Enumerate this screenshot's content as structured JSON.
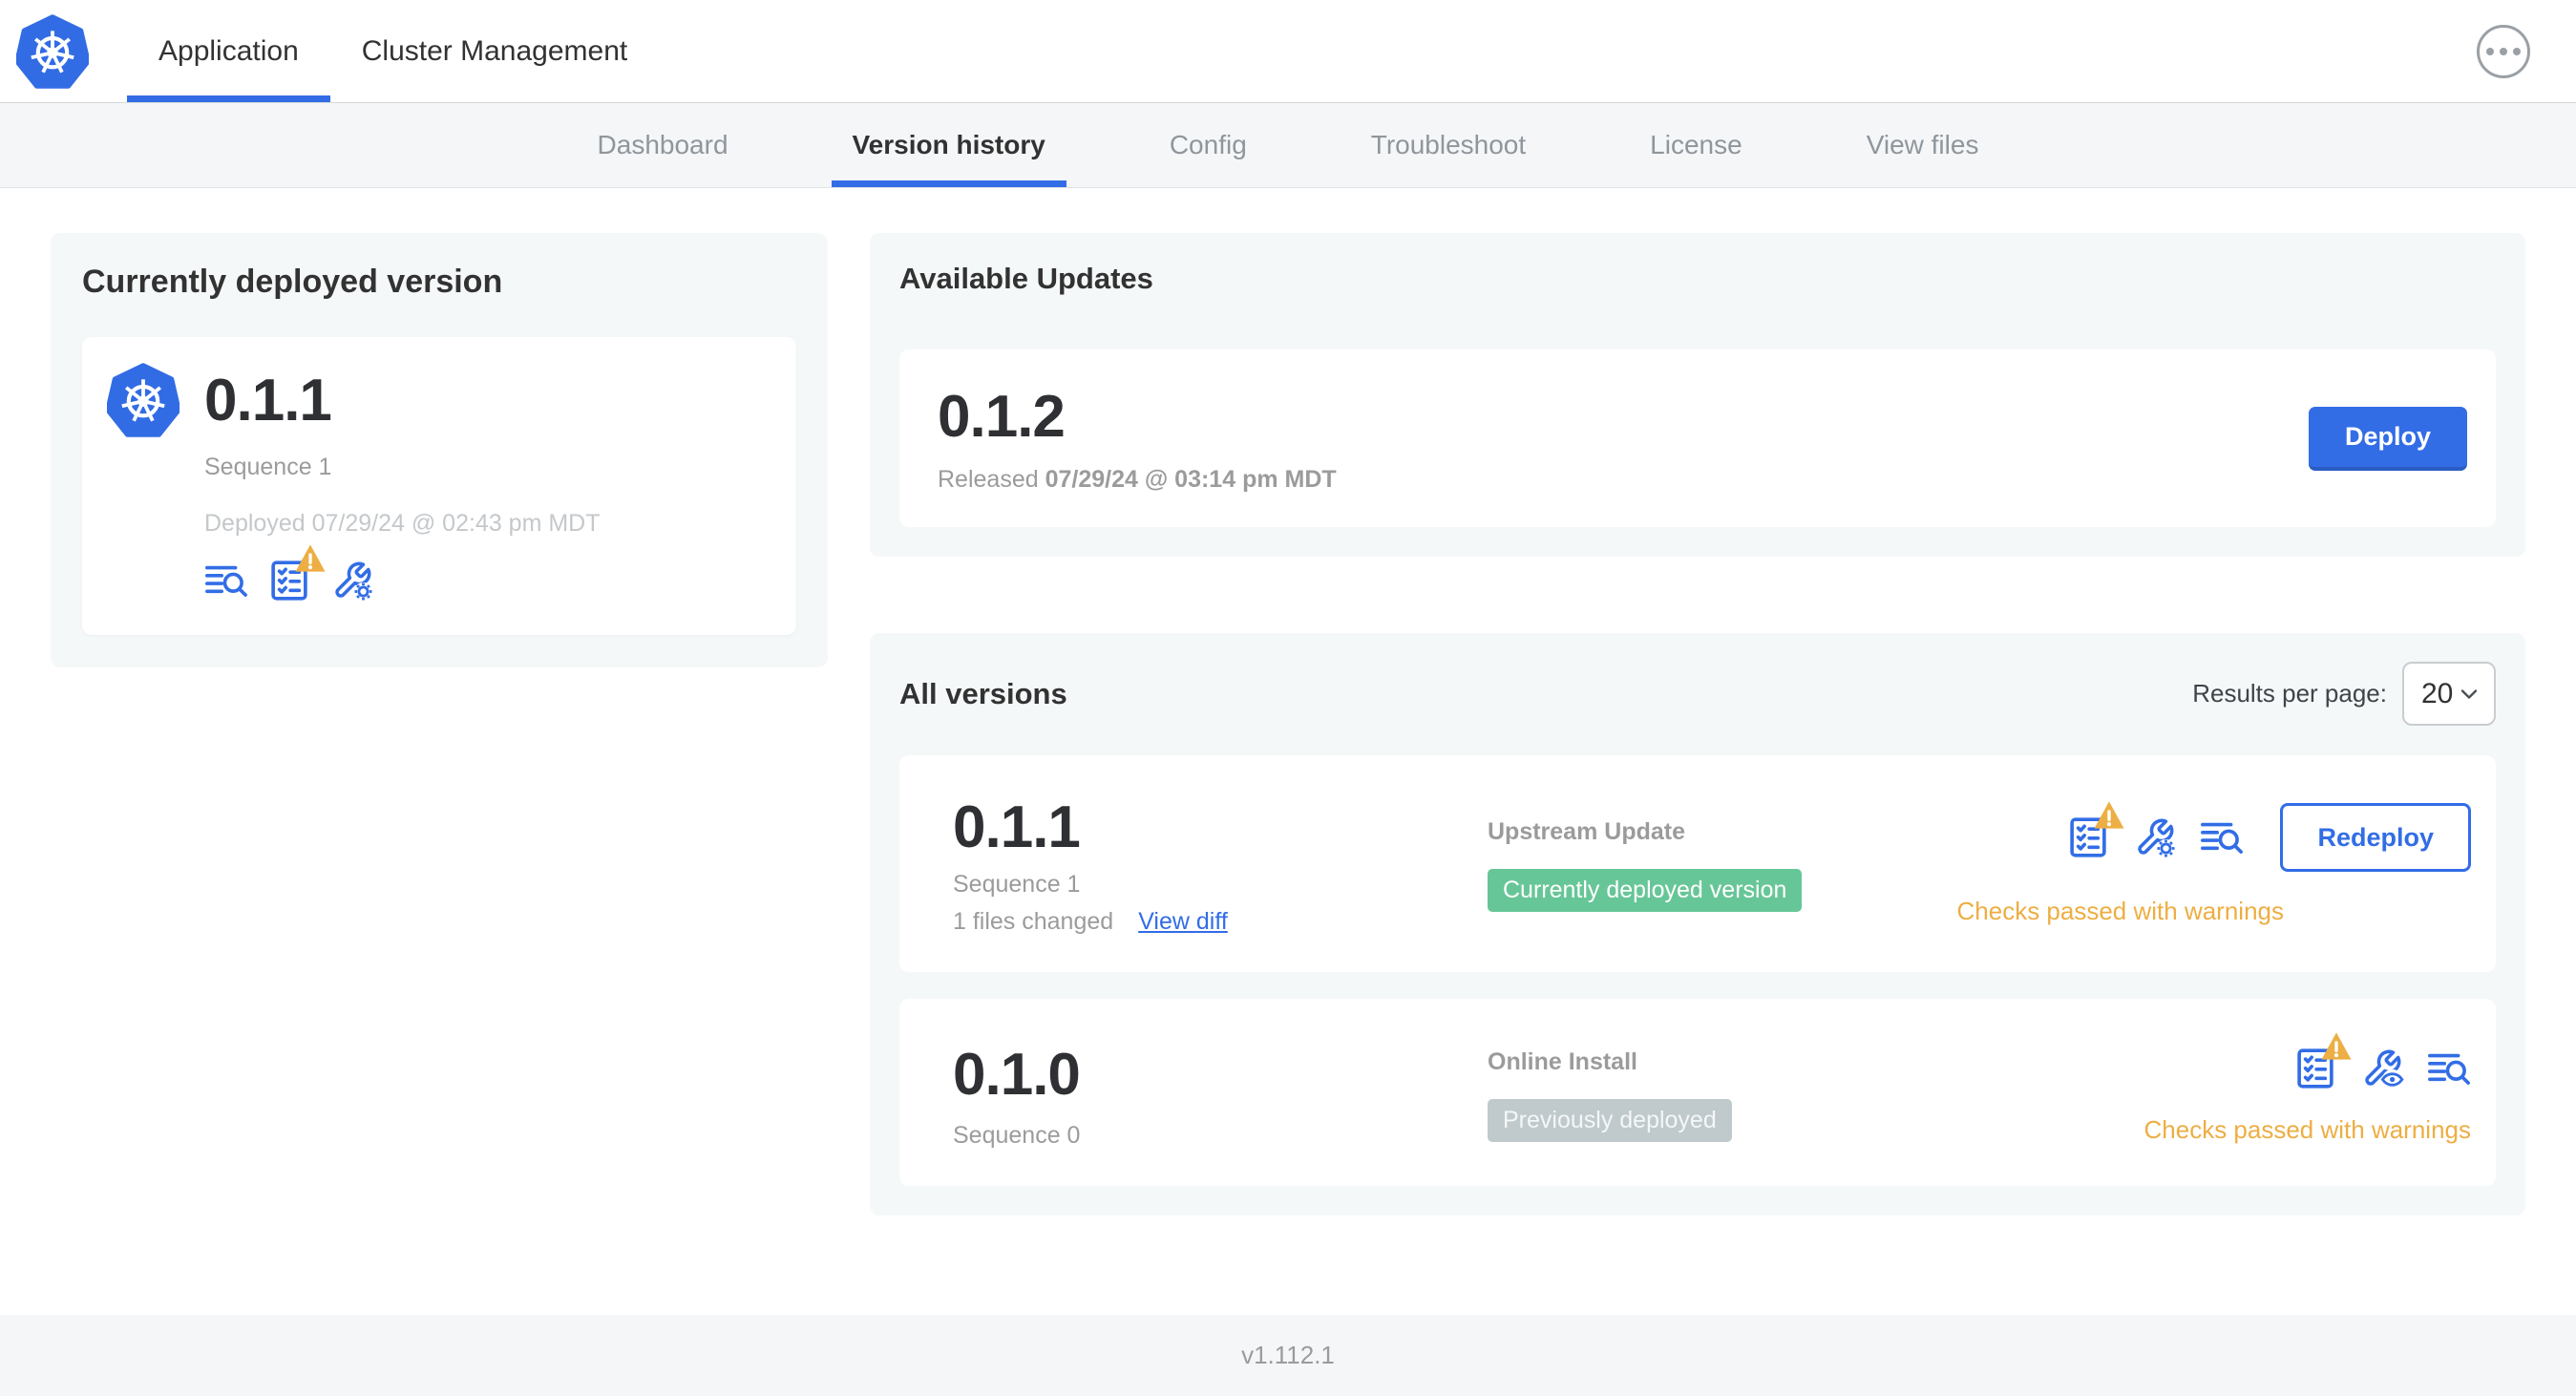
{
  "topbar": {
    "tabs": [
      {
        "label": "Application",
        "active": true
      },
      {
        "label": "Cluster Management",
        "active": false
      }
    ],
    "more_icon": "ellipsis-icon",
    "logo_icon": "kubernetes-logo-icon"
  },
  "subnav": {
    "tabs": [
      {
        "label": "Dashboard",
        "active": false
      },
      {
        "label": "Version history",
        "active": true
      },
      {
        "label": "Config",
        "active": false
      },
      {
        "label": "Troubleshoot",
        "active": false
      },
      {
        "label": "License",
        "active": false
      },
      {
        "label": "View files",
        "active": false
      }
    ]
  },
  "deployed_card": {
    "title": "Currently deployed version",
    "version": "0.1.1",
    "sequence": "Sequence 1",
    "deployed_prefix": "Deployed",
    "deployed_date": "07/29/24 @ 02:43 pm MDT",
    "icons": [
      "view-logs-icon",
      "preflight-checks-warning-icon",
      "edit-config-icon"
    ]
  },
  "available_updates": {
    "title": "Available Updates",
    "version": "0.1.2",
    "released_prefix": "Released",
    "released_date": "07/29/24 @ 03:14 pm MDT",
    "deploy_label": "Deploy"
  },
  "all_versions": {
    "title": "All versions",
    "results_per_page_label": "Results per page:",
    "results_per_page_value": "20",
    "rows": [
      {
        "version": "0.1.1",
        "sequence": "Sequence 1",
        "files_changed": "1 files changed",
        "view_diff_label": "View diff",
        "source": "Upstream Update",
        "status_label": "Currently deployed version",
        "status_type": "success",
        "checks_label": "Checks passed with warnings",
        "action_label": "Redeploy",
        "icons": [
          "preflight-checks-warning-icon",
          "edit-config-icon",
          "view-logs-icon"
        ]
      },
      {
        "version": "0.1.0",
        "sequence": "Sequence 0",
        "source": "Online Install",
        "status_label": "Previously deployed",
        "status_type": "muted",
        "checks_label": "Checks passed with warnings",
        "icons": [
          "preflight-checks-warning-icon",
          "view-config-icon",
          "view-logs-icon"
        ]
      }
    ]
  },
  "footer": {
    "version": "v1.112.1"
  },
  "colors": {
    "primary_blue": "#326de6",
    "success_green": "#67c697",
    "muted_badge_gray": "#c0cacc",
    "warning_amber": "#edae43",
    "card_background": "#f5f8f9",
    "subnav_background": "#f4f6f8",
    "text_dark": "#323232",
    "text_gray": "#9b9b9b",
    "text_light_gray": "#c4c8cb"
  }
}
